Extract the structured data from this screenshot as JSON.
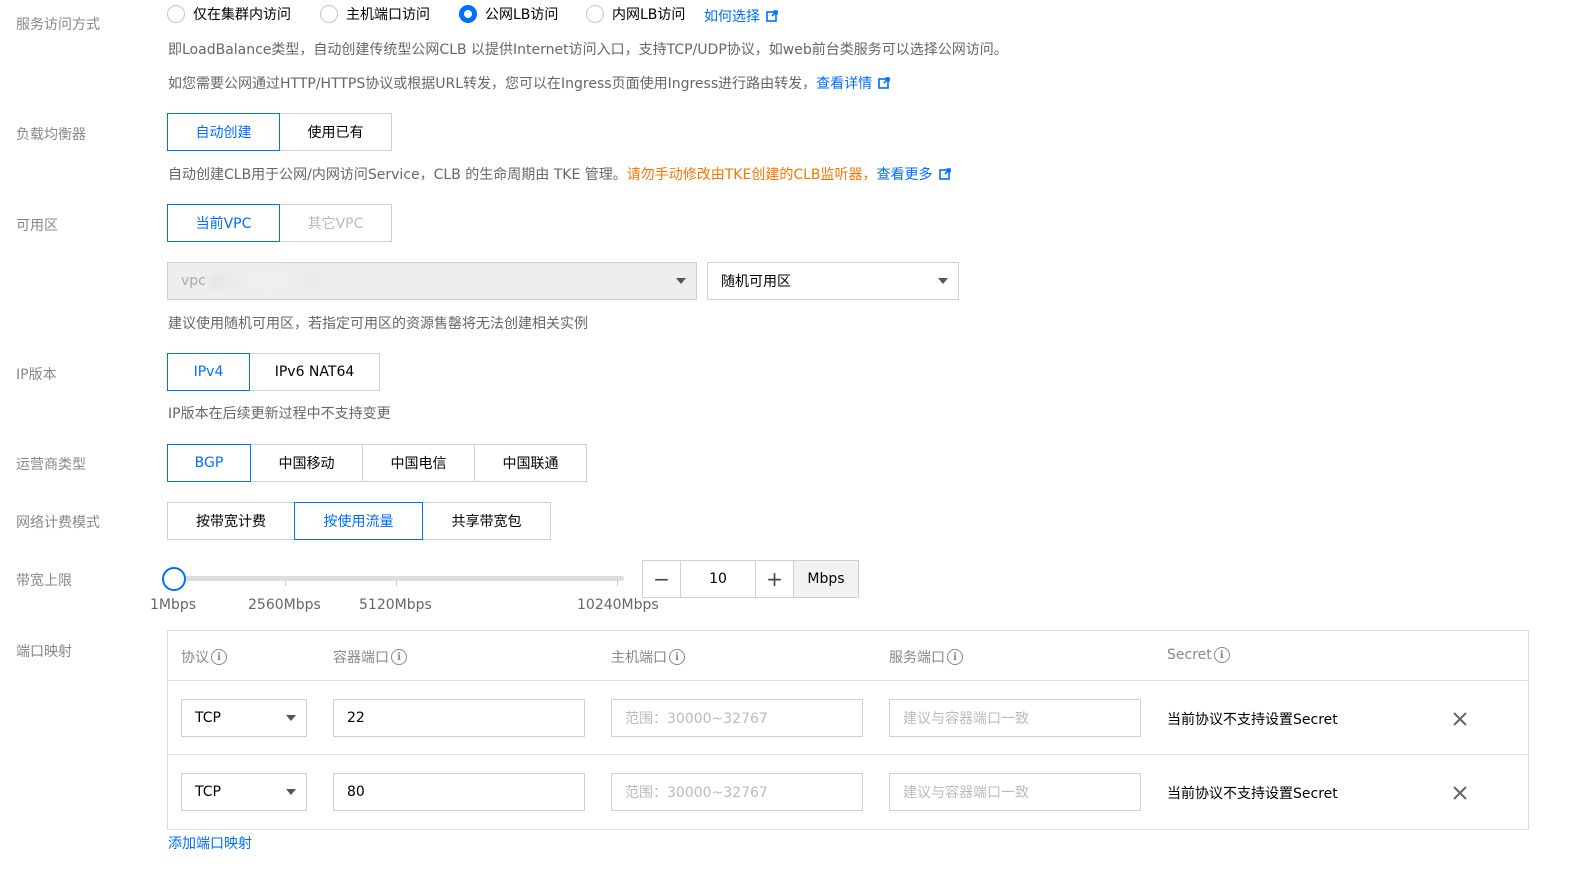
{
  "service_access": {
    "label": "服务访问方式",
    "options": [
      "仅在集群内访问",
      "主机端口访问",
      "公网LB访问",
      "内网LB访问"
    ],
    "selected": "公网LB访问",
    "help_link": "如何选择",
    "desc1": "即LoadBalance类型，自动创建传统型公网CLB 以提供Internet访问入口，支持TCP/UDP协议，如web前台类服务可以选择公网访问。",
    "desc2": "如您需要公网通过HTTP/HTTPS协议或根据URL转发，您可以在Ingress页面使用Ingress进行路由转发，",
    "desc2_link": "查看详情"
  },
  "load_balancer": {
    "label": "负载均衡器",
    "options": [
      "自动创建",
      "使用已有"
    ],
    "selected": "自动创建",
    "desc": "自动创建CLB用于公网/内网访问Service，CLB 的生命周期由 TKE 管理。",
    "warning": "请勿手动修改由TKE创建的CLB监听器，",
    "link": "查看更多"
  },
  "availability_zone": {
    "label": "可用区",
    "options": [
      "当前VPC",
      "其它VPC"
    ],
    "selected": "当前VPC",
    "vpc_value": "vpc",
    "zone_value": "随机可用区",
    "desc": "建议使用随机可用区，若指定可用区的资源售罄将无法创建相关实例"
  },
  "ip_version": {
    "label": "IP版本",
    "options": [
      "IPv4",
      "IPv6 NAT64"
    ],
    "selected": "IPv4",
    "desc": "IP版本在后续更新过程中不支持变更"
  },
  "isp_type": {
    "label": "运营商类型",
    "options": [
      "BGP",
      "中国移动",
      "中国电信",
      "中国联通"
    ],
    "selected": "BGP"
  },
  "billing_mode": {
    "label": "网络计费模式",
    "options": [
      "按带宽计费",
      "按使用流量",
      "共享带宽包"
    ],
    "selected": "按使用流量"
  },
  "bandwidth": {
    "label": "带宽上限",
    "value": "10",
    "minus": "−",
    "plus": "+",
    "unit": "Mbps",
    "ticks": [
      "1Mbps",
      "2560Mbps",
      "5120Mbps",
      "10240Mbps"
    ]
  },
  "port_mapping": {
    "label": "端口映射",
    "headers": [
      "协议",
      "容器端口",
      "主机端口",
      "服务端口",
      "Secret"
    ],
    "rows": [
      {
        "protocol": "TCP",
        "container_port": "22",
        "host_port_placeholder": "范围：30000~32767",
        "service_port_placeholder": "建议与容器端口一致",
        "secret": "当前协议不支持设置Secret"
      },
      {
        "protocol": "TCP",
        "container_port": "80",
        "host_port_placeholder": "范围：30000~32767",
        "service_port_placeholder": "建议与容器端口一致",
        "secret": "当前协议不支持设置Secret"
      }
    ],
    "add_link": "添加端口映射"
  },
  "colors": {
    "accent": "#006eff",
    "warning": "#ff7200",
    "label": "#888888",
    "help": "#666666"
  }
}
